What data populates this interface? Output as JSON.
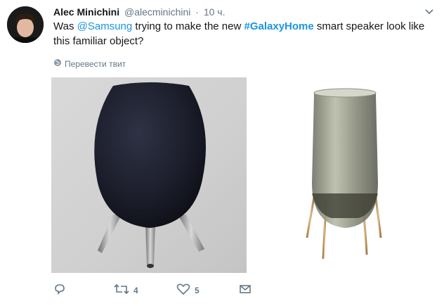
{
  "tweet": {
    "author_name": "Alec Minichini",
    "author_handle": "@alecminichini",
    "separator": "·",
    "time": "10 ч.",
    "text_prefix": "Was ",
    "mention": "@Samsung",
    "text_middle": " trying to make the new ",
    "hashtag": "#GalaxyHome",
    "text_suffix": " smart speaker look like this familiar object?",
    "translate_label": "Перевести твит"
  },
  "actions": {
    "reply_count": "",
    "retweet_count": "4",
    "like_count": "5"
  },
  "icons": {
    "avatar": "profile-photo",
    "caret": "chevron-down-icon",
    "translate": "globe-icon",
    "reply": "reply-icon",
    "retweet": "retweet-icon",
    "like": "heart-icon",
    "dm": "envelope-icon"
  },
  "colors": {
    "link": "#1b95e0",
    "muted": "#657786",
    "text": "#14171a"
  }
}
